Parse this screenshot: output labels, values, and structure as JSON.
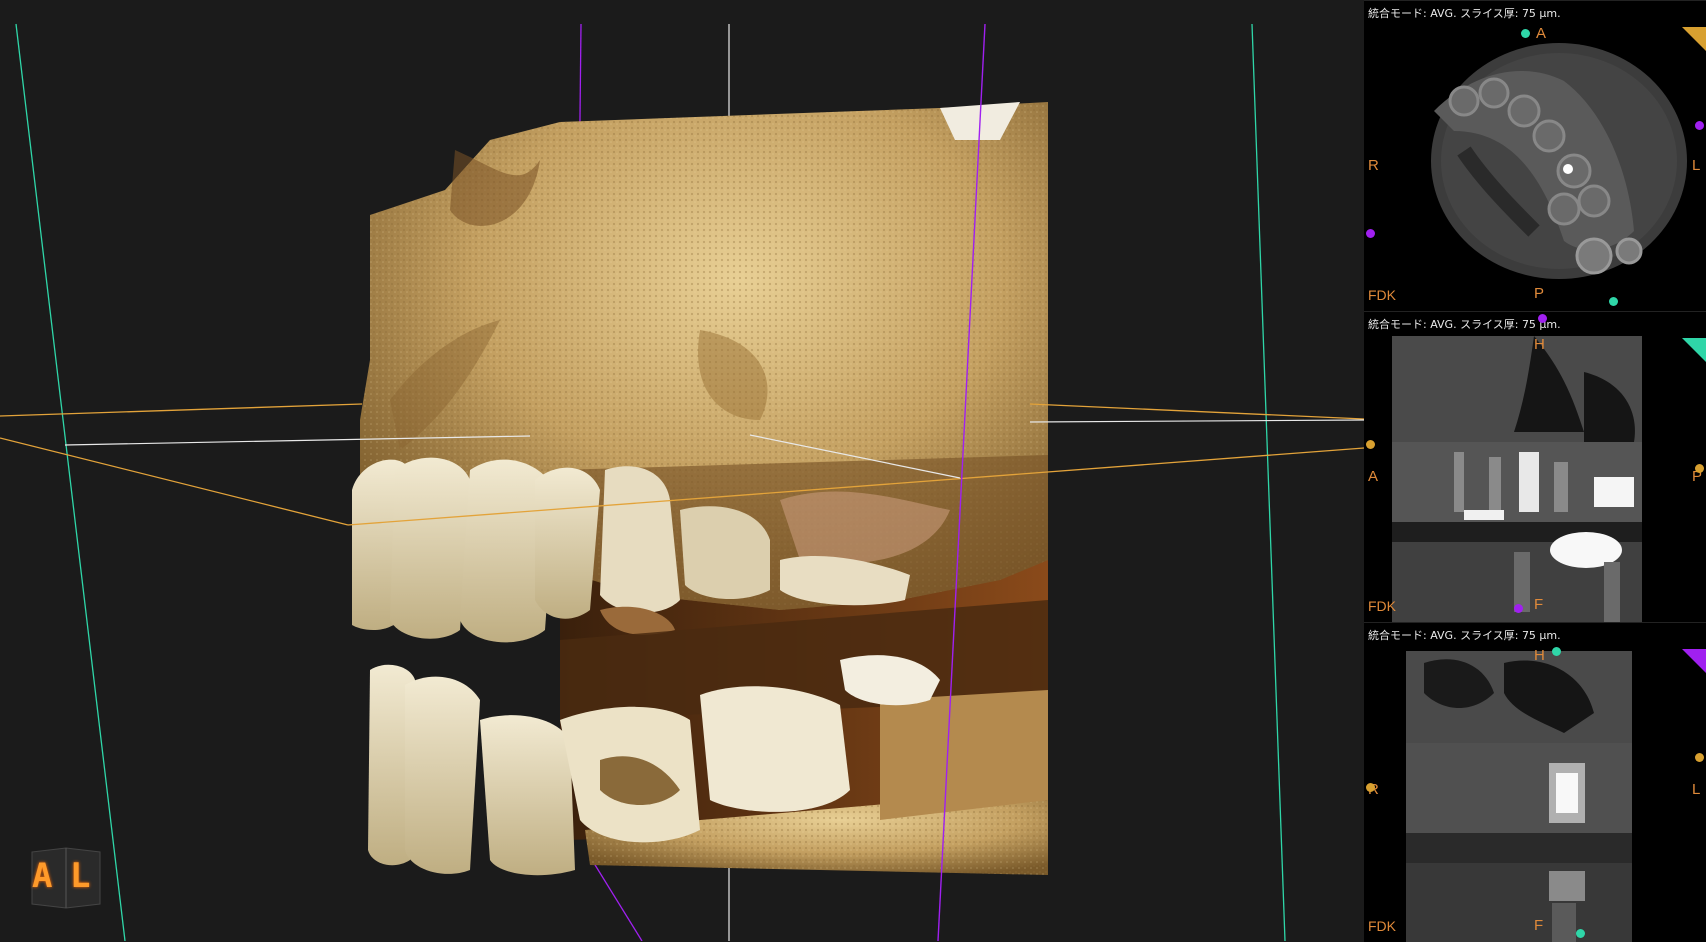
{
  "viewport3d": {
    "cube_labels": [
      "A",
      "L"
    ],
    "colors": {
      "axial_line": "#e3a33a",
      "coronal_line": "#2fd6a8",
      "sagittal_line": "#a020f0",
      "bone": "#b8955a"
    }
  },
  "panels": [
    {
      "mode_label": "統合モード: AVG. スライス厚: 75 μm.",
      "top": "A",
      "left": "R",
      "right": "L",
      "bottom": "P",
      "footer": "FDK",
      "accent": "#d8a030"
    },
    {
      "mode_label": "統合モード: AVG. スライス厚: 75 μm.",
      "top": "H",
      "left": "A",
      "right": "P",
      "bottom": "F",
      "footer": "FDK",
      "accent": "#2fd6a8"
    },
    {
      "mode_label": "統合モード: AVG. スライス厚: 75 μm.",
      "top": "H",
      "left": "R",
      "right": "L",
      "bottom": "F",
      "footer": "FDK",
      "accent": "#a020f0"
    }
  ]
}
